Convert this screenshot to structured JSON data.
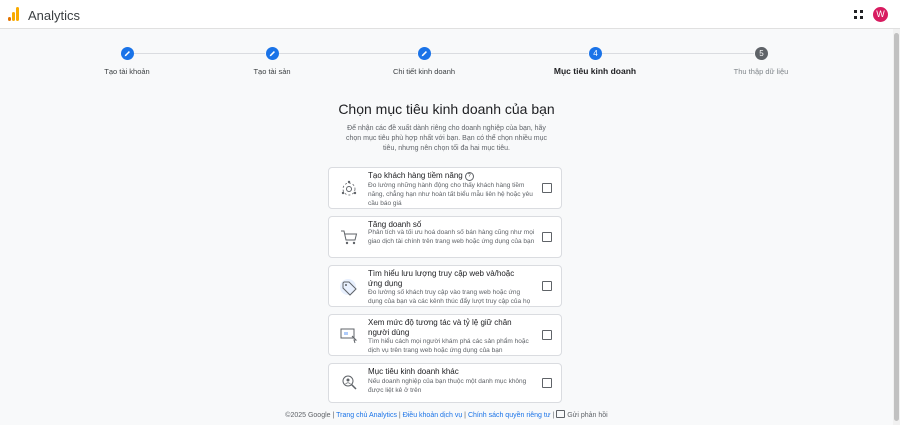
{
  "app": {
    "title": "Analytics",
    "avatar_letter": "W",
    "avatar_color": "#d81b60",
    "logo_colors": [
      "#f9ab00",
      "#e37400"
    ]
  },
  "stepper": {
    "steps": [
      {
        "label": "Tạo tài khoản",
        "state": "done",
        "icon": "pencil-icon"
      },
      {
        "label": "Tạo tài sản",
        "state": "done",
        "icon": "pencil-icon"
      },
      {
        "label": "Chi tiết kinh doanh",
        "state": "done",
        "icon": "pencil-icon"
      },
      {
        "label": "Mục tiêu kinh doanh",
        "state": "active",
        "number": "4"
      },
      {
        "label": "Thu thập dữ liệu",
        "state": "todo",
        "number": "5"
      }
    ],
    "accent_color": "#1a73e8"
  },
  "main": {
    "heading": "Chọn mục tiêu kinh doanh của bạn",
    "description": "Để nhận các đề xuất dành riêng cho doanh nghiệp của bạn, hãy chọn mục tiêu phù hợp nhất với bạn. Bạn có thể chọn nhiều mục tiêu, nhưng nên chọn tối đa hai mục tiêu.",
    "options": [
      {
        "title": "Tạo khách hàng tiềm năng",
        "has_help": true,
        "description": "Đo lường những hành động cho thấy khách hàng tiềm năng, chẳng hạn như hoàn tất biểu mẫu liên hệ hoặc yêu cầu báo giá",
        "icon": "target-people-icon",
        "checked": false
      },
      {
        "title": "Tăng doanh số",
        "has_help": false,
        "description": "Phân tích và tối ưu hoá doanh số bán hàng cũng như mọi giao dịch tài chính trên trang web hoặc ứng dụng của bạn",
        "icon": "shopping-cart-icon",
        "checked": false
      },
      {
        "title": "Tìm hiểu lưu lượng truy cập web và/hoặc ứng dụng",
        "has_help": false,
        "description": "Đo lường số khách truy cập vào trang web hoặc ứng dụng của bạn và các kênh thúc đẩy lượt truy cập của họ",
        "icon": "price-tag-icon",
        "checked": false
      },
      {
        "title": "Xem mức độ tương tác và tỷ lệ giữ chân người dùng",
        "has_help": false,
        "description": "Tìm hiểu cách mọi người khám phá các sản phẩm hoặc dịch vụ trên trang web hoặc ứng dụng của bạn",
        "icon": "monitor-engagement-icon",
        "checked": false
      },
      {
        "title": "Mục tiêu kinh doanh khác",
        "has_help": false,
        "description": "Nếu doanh nghiệp của bạn thuộc một danh mục không được liệt kê ở trên",
        "icon": "search-person-icon",
        "checked": false
      }
    ]
  },
  "footer": {
    "copyright": "©2025 Google",
    "links": [
      "Trang chủ Analytics",
      "Điều khoản dịch vụ",
      "Chính sách quyền riêng tư"
    ],
    "feedback": "Gửi phản hồi"
  }
}
